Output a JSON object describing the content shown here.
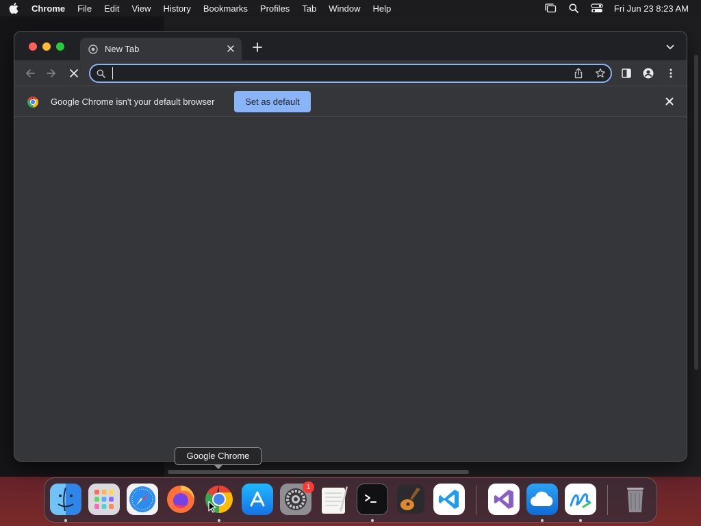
{
  "menubar": {
    "app_name": "Chrome",
    "items": [
      "File",
      "Edit",
      "View",
      "History",
      "Bookmarks",
      "Profiles",
      "Tab",
      "Window",
      "Help"
    ],
    "clock": "Fri Jun 23  8:23 AM",
    "status_icons": [
      "stage-manager-icon",
      "spotlight-search-icon",
      "control-center-icon"
    ]
  },
  "browser": {
    "tab": {
      "title": "New Tab"
    },
    "omnibox": {
      "value": "",
      "placeholder": ""
    },
    "infobar": {
      "message": "Google Chrome isn't your default browser",
      "button_label": "Set as default"
    },
    "accent_color": "#8ab4f8"
  },
  "dock": {
    "tooltip": "Google Chrome",
    "items": [
      {
        "name": "Finder",
        "running": true
      },
      {
        "name": "Launchpad",
        "running": false
      },
      {
        "name": "Safari",
        "running": false
      },
      {
        "name": "Firefox",
        "running": false
      },
      {
        "name": "Google Chrome",
        "running": true
      },
      {
        "name": "App Store",
        "running": false
      },
      {
        "name": "System Settings",
        "running": false,
        "badge": "1"
      },
      {
        "name": "TextEdit",
        "running": false
      },
      {
        "name": "Terminal",
        "running": true
      },
      {
        "name": "GarageBand",
        "running": false
      },
      {
        "name": "Visual Studio Code",
        "running": false
      },
      {
        "name": "Visual Studio",
        "running": false
      },
      {
        "name": "OneDrive",
        "running": true
      },
      {
        "name": "Freeform",
        "running": true
      },
      {
        "name": "Trash",
        "running": false
      }
    ]
  }
}
